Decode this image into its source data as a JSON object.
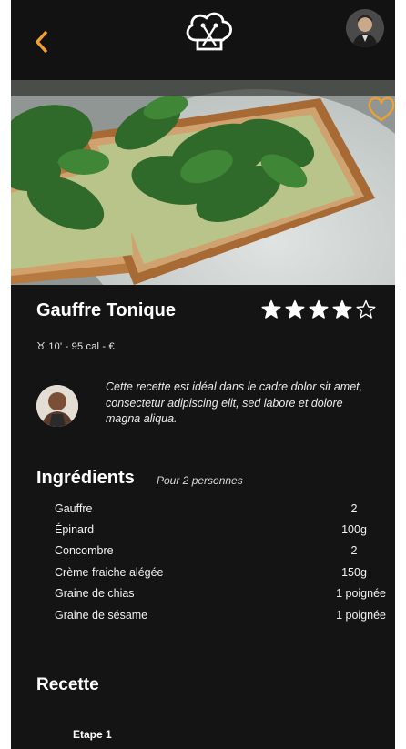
{
  "header": {
    "back_icon": "chevron-left-icon",
    "logo_icon": "chef-hat-logo-icon",
    "accent": "#f0a030"
  },
  "recipe": {
    "title": "Gauffre Tonique",
    "rating": 4,
    "rating_max": 5,
    "meta": "♉ 10' - 95 cal - €",
    "description": "Cette recette est idéal dans le cadre dolor sit amet, consectetur adipiscing elit, sed labore et dolore magna aliqua."
  },
  "ingredients": {
    "title": "Ingrédients",
    "subtitle": "Pour 2 personnes",
    "items": [
      {
        "name": "Gauffre",
        "qty": "2"
      },
      {
        "name": "Épinard",
        "qty": "100g"
      },
      {
        "name": "Concombre",
        "qty": "2"
      },
      {
        "name": "Crème fraiche alégée",
        "qty": "150g"
      },
      {
        "name": "Graine de chias",
        "qty": "1 poignée"
      },
      {
        "name": "Graine de sésame",
        "qty": "1 poignée"
      }
    ]
  },
  "recette": {
    "title": "Recette",
    "step_label": "Etape 1"
  }
}
